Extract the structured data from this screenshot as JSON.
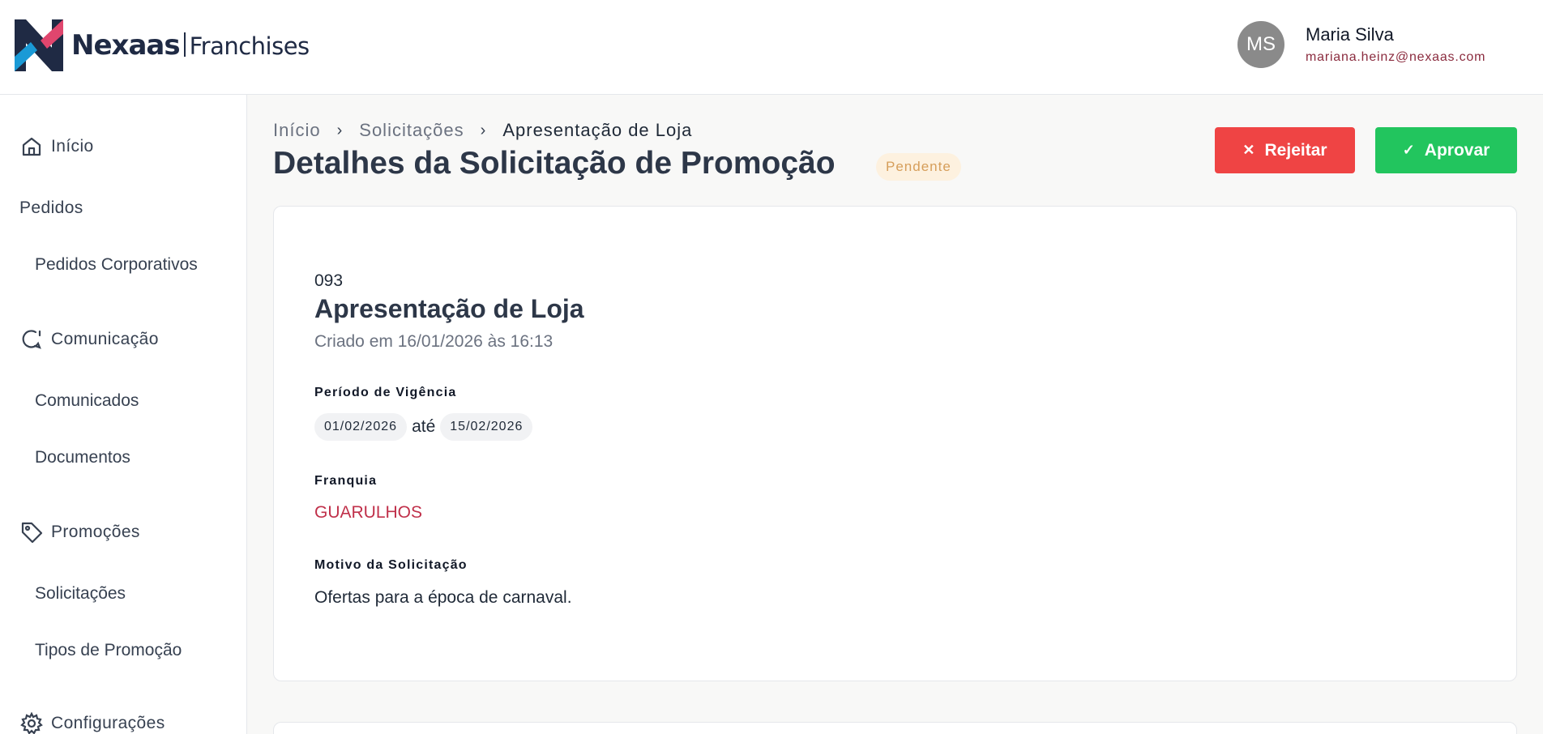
{
  "header": {
    "brand": "Nexaas",
    "brand_sub": "Franchises",
    "colors": {
      "logo_navy": "#1f2a44",
      "logo_pink": "#e0466e",
      "logo_blue": "#1a9ad6"
    }
  },
  "user": {
    "initials": "MS",
    "name": "Maria Silva",
    "email": "mariana.heinz@nexaas.com"
  },
  "sidebar": {
    "inicio": {
      "label": "Início",
      "icon": "home-icon"
    },
    "pedidos": {
      "label": "Pedidos"
    },
    "pedidos_corporativos": {
      "label": "Pedidos Corporativos"
    },
    "comunicacao": {
      "label": "Comunicação",
      "icon": "chat-icon"
    },
    "comunicados": {
      "label": "Comunicados"
    },
    "documentos": {
      "label": "Documentos"
    },
    "promocoes": {
      "label": "Promoções",
      "icon": "tag-icon"
    },
    "solicitacoes": {
      "label": "Solicitações"
    },
    "tipos_promocao": {
      "label": "Tipos de Promoção"
    },
    "configuracoes": {
      "label": "Configurações",
      "icon": "gear-icon"
    }
  },
  "breadcrumb": {
    "items": [
      "Início",
      "Solicitações",
      "Apresentação de Loja"
    ]
  },
  "page": {
    "title": "Detalhes da Solicitação de Promoção",
    "status": "Pendente"
  },
  "actions": {
    "reject_label": "Rejeitar",
    "approve_label": "Aprovar",
    "colors": {
      "reject": "#ef4444",
      "approve": "#22c55e"
    }
  },
  "promotion": {
    "code": "093",
    "title": "Apresentação de Loja",
    "created": "Criado em 16/01/2026 às 16:13",
    "period_label": "Período de Vigência",
    "period_start": "01/02/2026",
    "period_connector": "até",
    "period_end": "15/02/2026",
    "franchise_label": "Franquia",
    "franchise": "GUARULHOS",
    "reason_label": "Motivo da Solicitação",
    "reason": "Ofertas para a época de carnaval."
  }
}
